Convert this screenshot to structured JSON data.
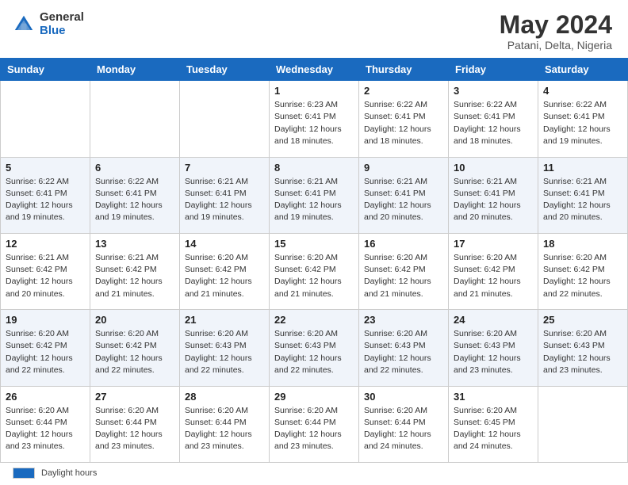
{
  "header": {
    "logo_general": "General",
    "logo_blue": "Blue",
    "month_title": "May 2024",
    "location": "Patani, Delta, Nigeria"
  },
  "footer": {
    "legend_label": "Daylight hours"
  },
  "calendar": {
    "headers": [
      "Sunday",
      "Monday",
      "Tuesday",
      "Wednesday",
      "Thursday",
      "Friday",
      "Saturday"
    ],
    "weeks": [
      [
        {
          "day": "",
          "info": ""
        },
        {
          "day": "",
          "info": ""
        },
        {
          "day": "",
          "info": ""
        },
        {
          "day": "1",
          "info": "Sunrise: 6:23 AM\nSunset: 6:41 PM\nDaylight: 12 hours and 18 minutes."
        },
        {
          "day": "2",
          "info": "Sunrise: 6:22 AM\nSunset: 6:41 PM\nDaylight: 12 hours and 18 minutes."
        },
        {
          "day": "3",
          "info": "Sunrise: 6:22 AM\nSunset: 6:41 PM\nDaylight: 12 hours and 18 minutes."
        },
        {
          "day": "4",
          "info": "Sunrise: 6:22 AM\nSunset: 6:41 PM\nDaylight: 12 hours and 19 minutes."
        }
      ],
      [
        {
          "day": "5",
          "info": "Sunrise: 6:22 AM\nSunset: 6:41 PM\nDaylight: 12 hours and 19 minutes."
        },
        {
          "day": "6",
          "info": "Sunrise: 6:22 AM\nSunset: 6:41 PM\nDaylight: 12 hours and 19 minutes."
        },
        {
          "day": "7",
          "info": "Sunrise: 6:21 AM\nSunset: 6:41 PM\nDaylight: 12 hours and 19 minutes."
        },
        {
          "day": "8",
          "info": "Sunrise: 6:21 AM\nSunset: 6:41 PM\nDaylight: 12 hours and 19 minutes."
        },
        {
          "day": "9",
          "info": "Sunrise: 6:21 AM\nSunset: 6:41 PM\nDaylight: 12 hours and 20 minutes."
        },
        {
          "day": "10",
          "info": "Sunrise: 6:21 AM\nSunset: 6:41 PM\nDaylight: 12 hours and 20 minutes."
        },
        {
          "day": "11",
          "info": "Sunrise: 6:21 AM\nSunset: 6:41 PM\nDaylight: 12 hours and 20 minutes."
        }
      ],
      [
        {
          "day": "12",
          "info": "Sunrise: 6:21 AM\nSunset: 6:42 PM\nDaylight: 12 hours and 20 minutes."
        },
        {
          "day": "13",
          "info": "Sunrise: 6:21 AM\nSunset: 6:42 PM\nDaylight: 12 hours and 21 minutes."
        },
        {
          "day": "14",
          "info": "Sunrise: 6:20 AM\nSunset: 6:42 PM\nDaylight: 12 hours and 21 minutes."
        },
        {
          "day": "15",
          "info": "Sunrise: 6:20 AM\nSunset: 6:42 PM\nDaylight: 12 hours and 21 minutes."
        },
        {
          "day": "16",
          "info": "Sunrise: 6:20 AM\nSunset: 6:42 PM\nDaylight: 12 hours and 21 minutes."
        },
        {
          "day": "17",
          "info": "Sunrise: 6:20 AM\nSunset: 6:42 PM\nDaylight: 12 hours and 21 minutes."
        },
        {
          "day": "18",
          "info": "Sunrise: 6:20 AM\nSunset: 6:42 PM\nDaylight: 12 hours and 22 minutes."
        }
      ],
      [
        {
          "day": "19",
          "info": "Sunrise: 6:20 AM\nSunset: 6:42 PM\nDaylight: 12 hours and 22 minutes."
        },
        {
          "day": "20",
          "info": "Sunrise: 6:20 AM\nSunset: 6:42 PM\nDaylight: 12 hours and 22 minutes."
        },
        {
          "day": "21",
          "info": "Sunrise: 6:20 AM\nSunset: 6:43 PM\nDaylight: 12 hours and 22 minutes."
        },
        {
          "day": "22",
          "info": "Sunrise: 6:20 AM\nSunset: 6:43 PM\nDaylight: 12 hours and 22 minutes."
        },
        {
          "day": "23",
          "info": "Sunrise: 6:20 AM\nSunset: 6:43 PM\nDaylight: 12 hours and 22 minutes."
        },
        {
          "day": "24",
          "info": "Sunrise: 6:20 AM\nSunset: 6:43 PM\nDaylight: 12 hours and 23 minutes."
        },
        {
          "day": "25",
          "info": "Sunrise: 6:20 AM\nSunset: 6:43 PM\nDaylight: 12 hours and 23 minutes."
        }
      ],
      [
        {
          "day": "26",
          "info": "Sunrise: 6:20 AM\nSunset: 6:44 PM\nDaylight: 12 hours and 23 minutes."
        },
        {
          "day": "27",
          "info": "Sunrise: 6:20 AM\nSunset: 6:44 PM\nDaylight: 12 hours and 23 minutes."
        },
        {
          "day": "28",
          "info": "Sunrise: 6:20 AM\nSunset: 6:44 PM\nDaylight: 12 hours and 23 minutes."
        },
        {
          "day": "29",
          "info": "Sunrise: 6:20 AM\nSunset: 6:44 PM\nDaylight: 12 hours and 23 minutes."
        },
        {
          "day": "30",
          "info": "Sunrise: 6:20 AM\nSunset: 6:44 PM\nDaylight: 12 hours and 24 minutes."
        },
        {
          "day": "31",
          "info": "Sunrise: 6:20 AM\nSunset: 6:45 PM\nDaylight: 12 hours and 24 minutes."
        },
        {
          "day": "",
          "info": ""
        }
      ]
    ]
  }
}
